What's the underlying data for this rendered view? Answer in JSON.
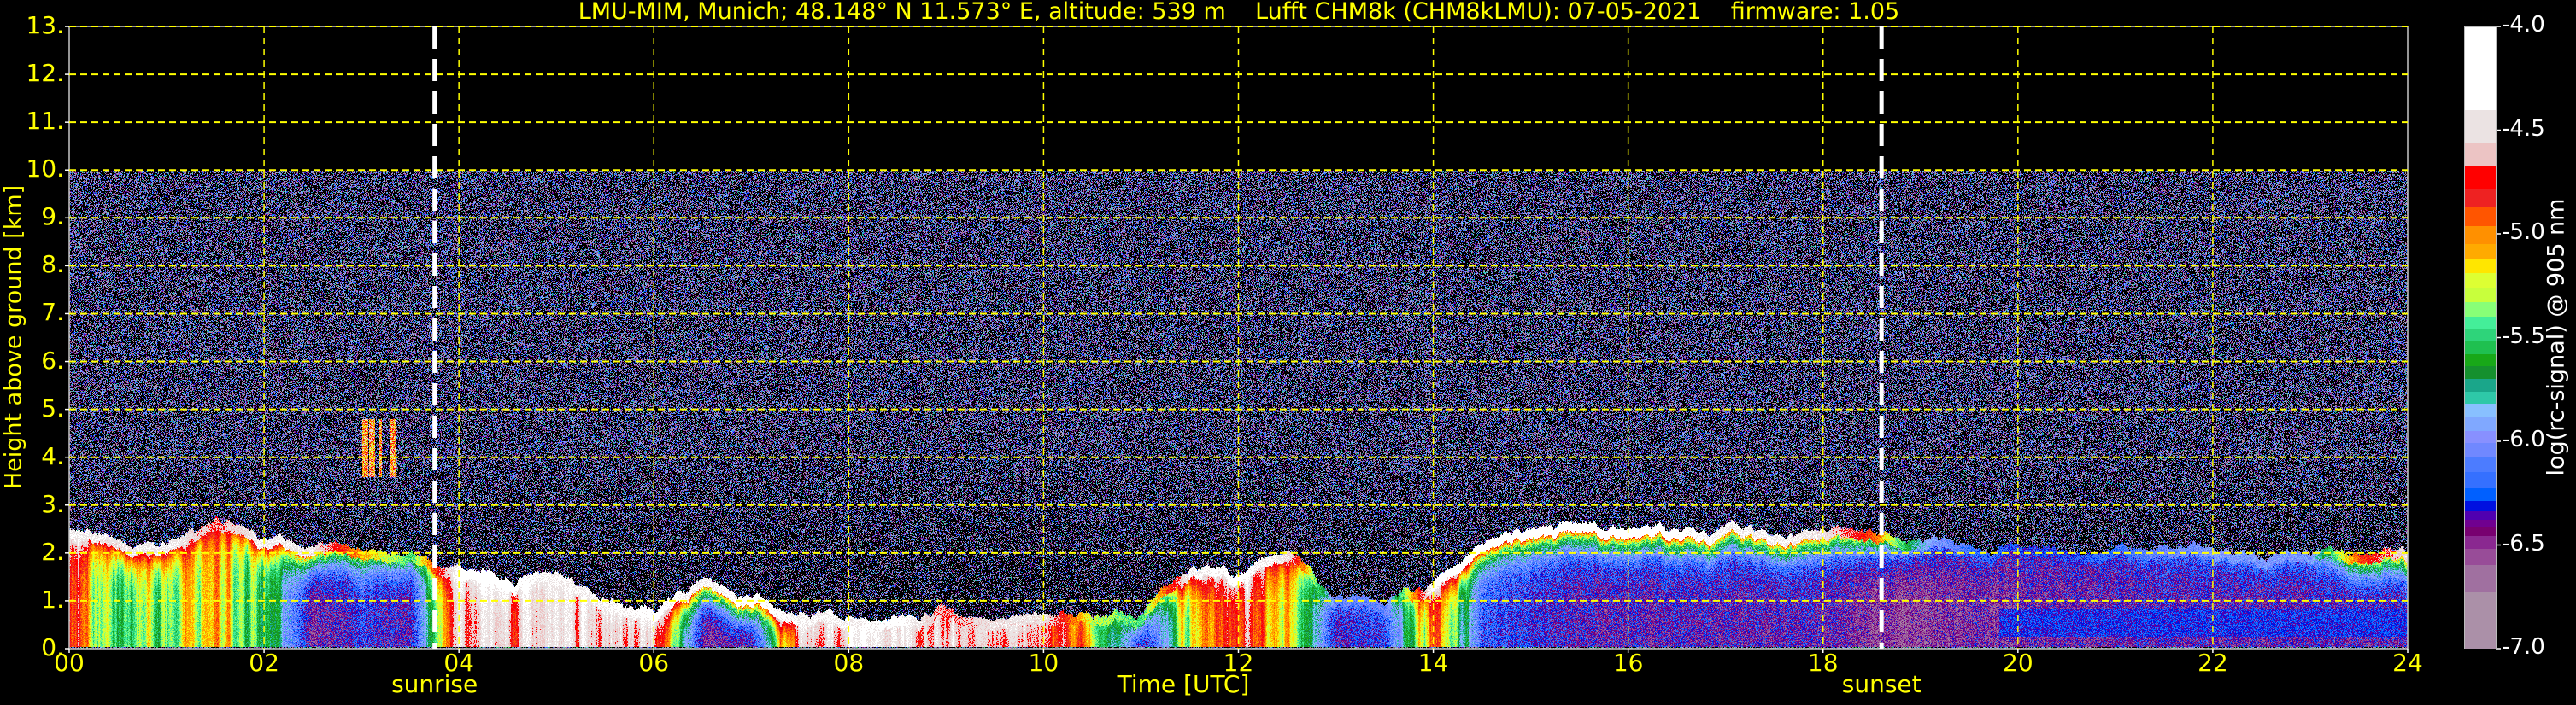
{
  "chart_data": {
    "type": "heatmap",
    "title": "LMU-MIM, Munich; 48.148° N 11.573° E, altitude: 539 m    Lufft CHM8k (CHM8kLMU): 07-05-2021    firmware: 1.05",
    "xlabel": "Time [UTC]",
    "ylabel": "Height above ground [km]",
    "xlim": [
      0,
      24
    ],
    "ylim": [
      0,
      13
    ],
    "grid": true,
    "x_ticks": [
      0,
      2,
      4,
      6,
      8,
      10,
      12,
      14,
      16,
      18,
      20,
      22,
      24
    ],
    "x_tick_labels": [
      "00",
      "02",
      "04",
      "06",
      "08",
      "10",
      "12",
      "14",
      "16",
      "18",
      "20",
      "22",
      "24"
    ],
    "y_ticks": [
      0,
      1,
      2,
      3,
      4,
      5,
      6,
      7,
      8,
      9,
      10,
      11,
      12,
      13
    ],
    "y_tick_labels": [
      "0.",
      "1.",
      "2.",
      "3.",
      "4.",
      "5.",
      "6.",
      "7.",
      "8.",
      "9.",
      "10.",
      "11.",
      "12.",
      "13."
    ],
    "annotations": [
      {
        "label": "sunrise",
        "time_h": 3.75
      },
      {
        "label": "sunset",
        "time_h": 18.6
      }
    ],
    "data_top_km": 10,
    "profile": {
      "time_h": [
        0,
        0.5,
        1,
        1.5,
        2,
        2.5,
        3,
        3.5,
        4,
        4.5,
        5,
        5.5,
        6,
        6.5,
        7,
        7.5,
        8,
        8.5,
        9,
        9.5,
        10,
        10.5,
        11,
        11.5,
        12,
        12.5,
        13,
        13.5,
        14,
        14.5,
        15,
        15.5,
        16,
        16.5,
        17,
        17.5,
        18,
        18.5,
        19,
        19.5,
        20,
        20.5,
        21,
        21.5,
        22,
        22.5,
        23,
        23.5,
        24
      ],
      "layer_top_km": [
        2.4,
        2.2,
        2.0,
        2.6,
        2.2,
        2.1,
        2.0,
        1.9,
        1.5,
        1.4,
        1.4,
        0.9,
        0.7,
        1.4,
        1.0,
        0.6,
        0.6,
        0.6,
        0.7,
        0.5,
        0.6,
        0.6,
        0.6,
        1.6,
        1.5,
        2.0,
        1.0,
        1.0,
        1.2,
        2.3,
        2.4,
        2.5,
        2.4,
        2.4,
        2.4,
        2.4,
        2.4,
        2.3,
        2.2,
        2.0,
        2.0,
        2.0,
        2.0,
        2.0,
        1.95,
        1.9,
        1.9,
        1.9,
        1.95
      ],
      "layer_top_log_signal": [
        -4.5,
        -4.6,
        -4.5,
        -4.8,
        -4.5,
        -4.6,
        -5.2,
        -5.6,
        -4.4,
        -4.4,
        -4.5,
        -4.5,
        -4.4,
        -4.5,
        -4.4,
        -4.5,
        -4.5,
        -4.4,
        -4.8,
        -4.6,
        -4.6,
        -5.4,
        -5.6,
        -4.5,
        -4.4,
        -4.6,
        -6.2,
        -6.2,
        -4.4,
        -4.4,
        -4.4,
        -4.4,
        -4.4,
        -4.4,
        -4.5,
        -4.5,
        -4.6,
        -5.0,
        -6.0,
        -6.3,
        -6.4,
        -6.4,
        -6.3,
        -6.2,
        -6.1,
        -6.1,
        -6.1,
        -5.0,
        -4.6
      ],
      "layer_interior_log_signal": [
        -5.0,
        -5.6,
        -5.5,
        -5.2,
        -5.6,
        -6.6,
        -6.4,
        -6.5,
        -4.7,
        -4.7,
        -4.6,
        -4.7,
        -4.7,
        -6.6,
        -6.6,
        -4.8,
        -4.6,
        -4.5,
        -4.7,
        -4.8,
        -4.7,
        -5.2,
        -6.6,
        -5.3,
        -4.8,
        -5.2,
        -6.5,
        -6.4,
        -5.0,
        -6.3,
        -6.4,
        -6.5,
        -6.5,
        -6.5,
        -6.5,
        -6.5,
        -6.5,
        -6.6,
        -6.6,
        -6.6,
        -6.55,
        -6.55,
        -6.5,
        -6.5,
        -6.5,
        -6.5,
        -6.5,
        -6.5,
        -6.5
      ]
    },
    "elevated_cloud": {
      "time_h": [
        3.0,
        3.35
      ],
      "height_km": [
        3.6,
        4.8
      ],
      "log_signal": -5.0
    },
    "near_surface_band": {
      "time_h": [
        19.8,
        24
      ],
      "height_km": [
        0.25,
        0.85
      ],
      "log_signal": -6.3
    },
    "colorbar": {
      "label": "log(rc-signal) @ 905 nm",
      "range": [
        -7.0,
        -4.0
      ],
      "tick_labels": [
        "-4.0",
        "-4.5",
        "-5.0",
        "-5.5",
        "-6.0",
        "-6.5",
        "-7.0"
      ],
      "ticks": [
        -4.0,
        -4.5,
        -5.0,
        -5.5,
        -6.0,
        -6.5,
        -7.0
      ],
      "levels": [
        {
          "from": -4.4,
          "to": -4.0,
          "color": "#ffffff"
        },
        {
          "from": -4.56,
          "to": -4.4,
          "color": "#ebe3e3"
        },
        {
          "from": -4.67,
          "to": -4.56,
          "color": "#ecc4c4"
        },
        {
          "from": -4.78,
          "to": -4.67,
          "color": "#ff0000"
        },
        {
          "from": -4.87,
          "to": -4.78,
          "color": "#ee2222"
        },
        {
          "from": -4.96,
          "to": -4.87,
          "color": "#ff5500"
        },
        {
          "from": -5.05,
          "to": -4.96,
          "color": "#ff9000"
        },
        {
          "from": -5.12,
          "to": -5.05,
          "color": "#ffaa00"
        },
        {
          "from": -5.19,
          "to": -5.12,
          "color": "#ffe600"
        },
        {
          "from": -5.26,
          "to": -5.19,
          "color": "#ddff33"
        },
        {
          "from": -5.33,
          "to": -5.26,
          "color": "#c8ff3c"
        },
        {
          "from": -5.4,
          "to": -5.33,
          "color": "#88ff77"
        },
        {
          "from": -5.46,
          "to": -5.4,
          "color": "#44ee99"
        },
        {
          "from": -5.52,
          "to": -5.46,
          "color": "#2ed47a"
        },
        {
          "from": -5.58,
          "to": -5.52,
          "color": "#1fc050"
        },
        {
          "from": -5.64,
          "to": -5.58,
          "color": "#18a818"
        },
        {
          "from": -5.7,
          "to": -5.64,
          "color": "#15902e"
        },
        {
          "from": -5.76,
          "to": -5.7,
          "color": "#1aa68a"
        },
        {
          "from": -5.82,
          "to": -5.76,
          "color": "#2ec8a8"
        },
        {
          "from": -5.88,
          "to": -5.82,
          "color": "#88c0ff"
        },
        {
          "from": -5.95,
          "to": -5.88,
          "color": "#80a8ff"
        },
        {
          "from": -6.01,
          "to": -5.95,
          "color": "#8890ff"
        },
        {
          "from": -6.08,
          "to": -6.01,
          "color": "#7088ff"
        },
        {
          "from": -6.15,
          "to": -6.08,
          "color": "#4c7cff"
        },
        {
          "from": -6.23,
          "to": -6.15,
          "color": "#3570ff"
        },
        {
          "from": -6.29,
          "to": -6.23,
          "color": "#0060ff"
        },
        {
          "from": -6.34,
          "to": -6.29,
          "color": "#0010e0"
        },
        {
          "from": -6.38,
          "to": -6.34,
          "color": "#5000b0"
        },
        {
          "from": -6.42,
          "to": -6.38,
          "color": "#700090"
        },
        {
          "from": -6.46,
          "to": -6.42,
          "color": "#780070"
        },
        {
          "from": -6.52,
          "to": -6.46,
          "color": "#8a2890"
        },
        {
          "from": -6.6,
          "to": -6.52,
          "color": "#984c98"
        },
        {
          "from": -6.73,
          "to": -6.6,
          "color": "#a070a0"
        },
        {
          "from": -7.0,
          "to": -6.73,
          "color": "#ab90a8"
        }
      ]
    }
  },
  "colors": {
    "axis_text": "#ffff00",
    "grid": "#ffff00",
    "annotation_line": "#ffffff",
    "background": "#000000"
  }
}
